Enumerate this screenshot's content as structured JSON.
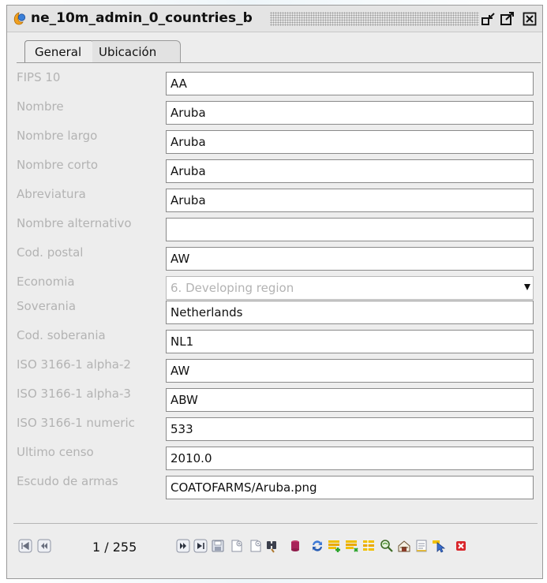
{
  "window": {
    "title": "ne_10m_admin_0_countries_b"
  },
  "tabs": [
    {
      "label": "General",
      "active": true
    },
    {
      "label": "Ubicación",
      "active": false
    }
  ],
  "fields": [
    {
      "label": "FIPS 10",
      "value": "AA"
    },
    {
      "label": "Nombre",
      "value": "Aruba"
    },
    {
      "label": "Nombre largo",
      "value": "Aruba"
    },
    {
      "label": "Nombre corto",
      "value": "Aruba"
    },
    {
      "label": "Abreviatura",
      "value": "Aruba"
    },
    {
      "label": "Nombre alternativo",
      "value": ""
    },
    {
      "label": "Cod. postal",
      "value": "AW"
    },
    {
      "label": "Economia",
      "value": "6. Developing region",
      "type": "combo"
    },
    {
      "label": "Soverania",
      "value": "Netherlands"
    },
    {
      "label": "Cod. soberania",
      "value": "NL1"
    },
    {
      "label": "ISO 3166-1 alpha-2",
      "value": "AW"
    },
    {
      "label": "ISO 3166-1 alpha-3",
      "value": "ABW"
    },
    {
      "label": "ISO 3166-1 numeric",
      "value": "533"
    },
    {
      "label": "Ultimo censo",
      "value": "2010.0"
    },
    {
      "label": "Escudo de armas",
      "value": "COATOFARMS/Aruba.png"
    }
  ],
  "navigation": {
    "record_counter": "1 / 255"
  },
  "icons": {
    "app": "gvsig-layer-icon",
    "titlebar": [
      "restore-icon",
      "maximize-icon",
      "close-icon"
    ],
    "nav_left": [
      "first-record-icon",
      "previous-record-icon"
    ],
    "nav_right": [
      "next-record-icon",
      "last-record-icon",
      "save-icon",
      "new-record-icon",
      "new-record-with-data-icon",
      "find-icon",
      "database-icon",
      "refresh-icon",
      "add-selection-icon",
      "remove-selection-icon",
      "selection-only-icon",
      "zoom-to-icon",
      "copy-icon",
      "report-icon",
      "select-tool-icon",
      "delete-icon"
    ]
  },
  "colors": {
    "label_text": "#b3b3b3",
    "window_bg": "#ededed",
    "field_bg": "#ffffff"
  }
}
